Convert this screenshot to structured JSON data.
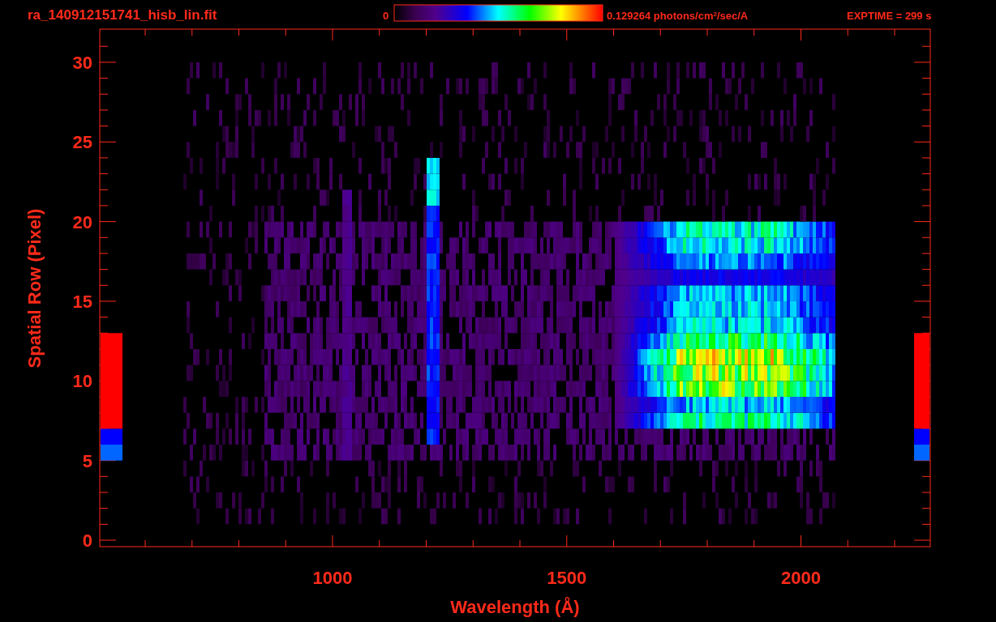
{
  "title": "ra_140912151741_hisb_lin.fit",
  "colorbar": {
    "min_label": "0",
    "max_label": "0.129264 photons/cm$^{2}$/sec/A"
  },
  "exposure": "EXPTIME = 299 s",
  "x_axis": {
    "label": "Wavelength (Å)",
    "ticks": [
      "1000",
      "1500",
      "2000"
    ]
  },
  "y_axis": {
    "label": "Spatial Row (Pixel)",
    "ticks": [
      "30",
      "25",
      "20",
      "15",
      "10",
      "5",
      "0"
    ]
  },
  "extraction_bars": [
    {
      "color": "#0066ff"
    },
    {
      "color": "#0000ff"
    },
    {
      "color": "#ff0000"
    }
  ]
}
